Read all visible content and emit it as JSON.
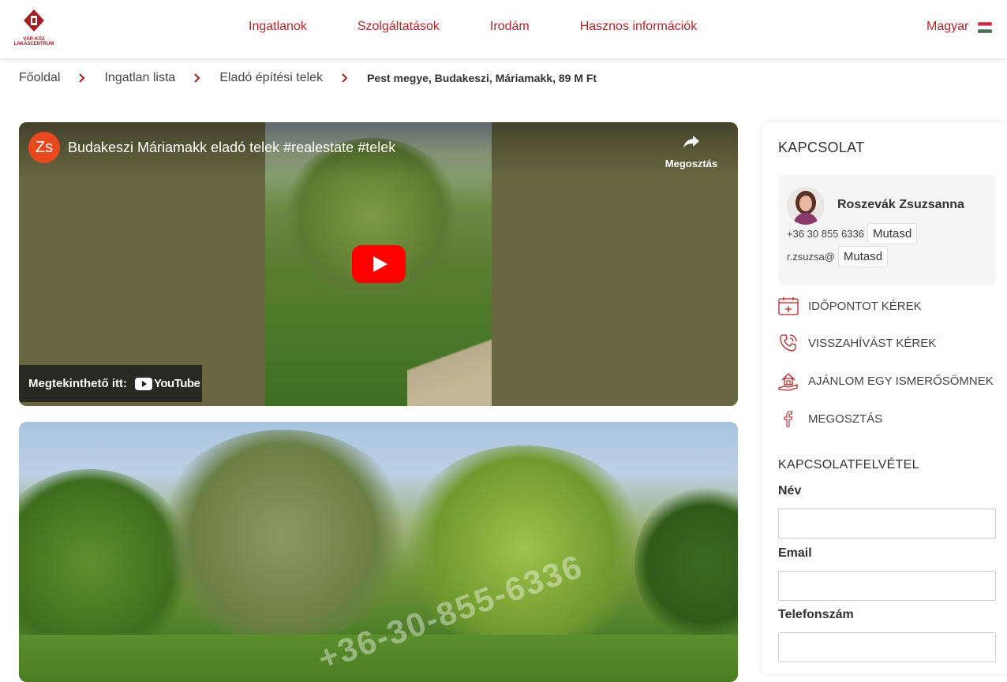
{
  "header": {
    "logo_text_line1": "VÁR-KÖZ",
    "logo_text_line2": "LAKÁSCENTRUM",
    "nav": [
      "Ingatlanok",
      "Szolgáltatások",
      "Irodám",
      "Hasznos információk"
    ],
    "language": "Magyar",
    "accent_color": "#b3262b"
  },
  "breadcrumb": {
    "items": [
      "Főoldal",
      "Ingatlan lista",
      "Eladó építési telek"
    ],
    "current": "Pest megye, Budakeszi, Máriamakk, 89 M Ft"
  },
  "video": {
    "channel_initials": "Zs",
    "title": "Budakeszi Máriamakk eladó telek #realestate #telek",
    "share_label": "Megosztás",
    "watch_on": "Megtekinthető itt:",
    "youtube_label": "YouTube"
  },
  "photo": {
    "watermark": "+36-30-855-6336"
  },
  "sidebar": {
    "title": "KAPCSOLAT",
    "agent": {
      "name": "Roszevák Zsuzsanna",
      "phone_partial": "+36 30 855 6336",
      "email_partial": "r.zsuzsa@",
      "reveal_label": "Mutasd"
    },
    "actions": [
      "IDŐPONTOT KÉREK",
      "VISSZAHÍVÁST KÉREK",
      "AJÁNLOM EGY ISMERŐSÖMNEK",
      "MEGOSZTÁS"
    ],
    "form": {
      "title": "KAPCSOLATFELVÉTEL",
      "name_label": "Név",
      "name_value": "",
      "email_label": "Email",
      "email_value": "",
      "phone_label": "Telefonszám",
      "phone_value": ""
    }
  }
}
